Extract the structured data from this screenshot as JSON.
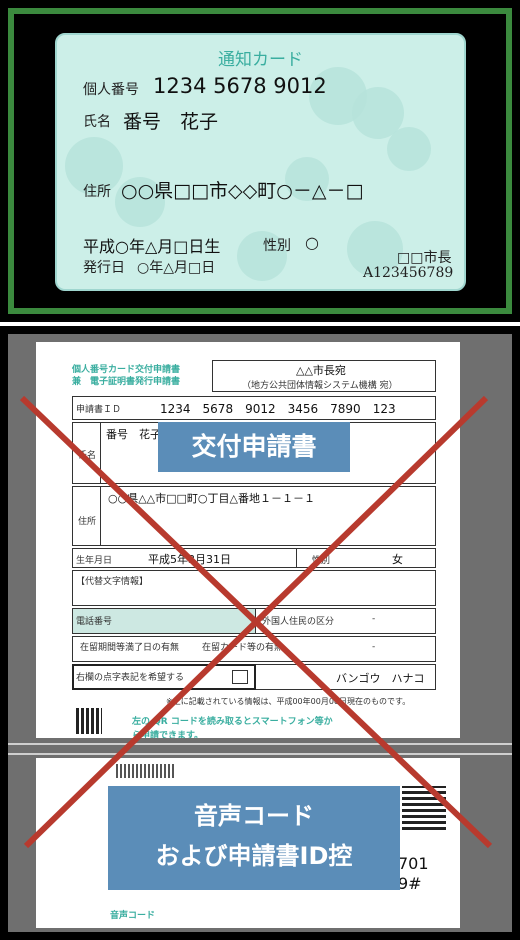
{
  "card": {
    "title": "通知カード",
    "number_label": "個人番号",
    "number_value": "1234 5678 9012",
    "name_label": "氏名",
    "name_value": "番号　花子",
    "address_label": "住所",
    "address_value": "○○県□□市◇◇町○－△－□",
    "birth_value": "平成○年△月□日生",
    "sex_label": "性別",
    "sex_value": "○",
    "issue_label": "発行日",
    "issue_value": "○年△月□日",
    "issuer": "□□市長",
    "serial": "A123456789"
  },
  "form": {
    "header_line1": "個人番号カード交付申請書",
    "header_line2": "兼　電子証明書発行申請書",
    "addressee": "△△市長宛",
    "addressee_sub": "（地方公共団体情報システム機構 宛）",
    "app_id_label": "申請書ＩＤ",
    "app_id_value": "1234　5678　9012　3456　7890　123",
    "name_label": "氏名",
    "name_value": "番号　花子",
    "address_label": "住所",
    "address_value": "○○県△△市□□町○丁目△番地１－１－１",
    "birth_label": "生年月日",
    "birth_value": "平成5年3月31日",
    "sex_label": "性別",
    "sex_value": "女",
    "alt_chars_label": "【代替文字情報】",
    "phone_label": "電話番号",
    "foreign_label": "外国人住民の区分",
    "dash1": "-",
    "stay_end_label": "在留期間等満了日の有無",
    "stay_card_label": "在留カード等の有無",
    "dash2": "-",
    "braille_label": "右欄の点字表記を希望する",
    "kana_value": "バンゴウ　ハナコ",
    "note_text": "※上に記載されている情報は、平成00年00月00日現在のものです。",
    "qr_text": "左の QR コードを読み取るとスマートフォン等か",
    "qr_text2": "ら申請できます。",
    "code_label": "音声コード",
    "id_tail1": "701",
    "id_tail2": "9#"
  },
  "overlays": {
    "application_label": "交付申請書",
    "voice_label_line1": "音声コード",
    "voice_label_line2": "および申請書ID控"
  },
  "colors": {
    "frame_green": "#3b8a3e",
    "card_bg": "#ccefe8",
    "label_blue": "#5b8db8",
    "cross_red": "#b83a2e"
  }
}
